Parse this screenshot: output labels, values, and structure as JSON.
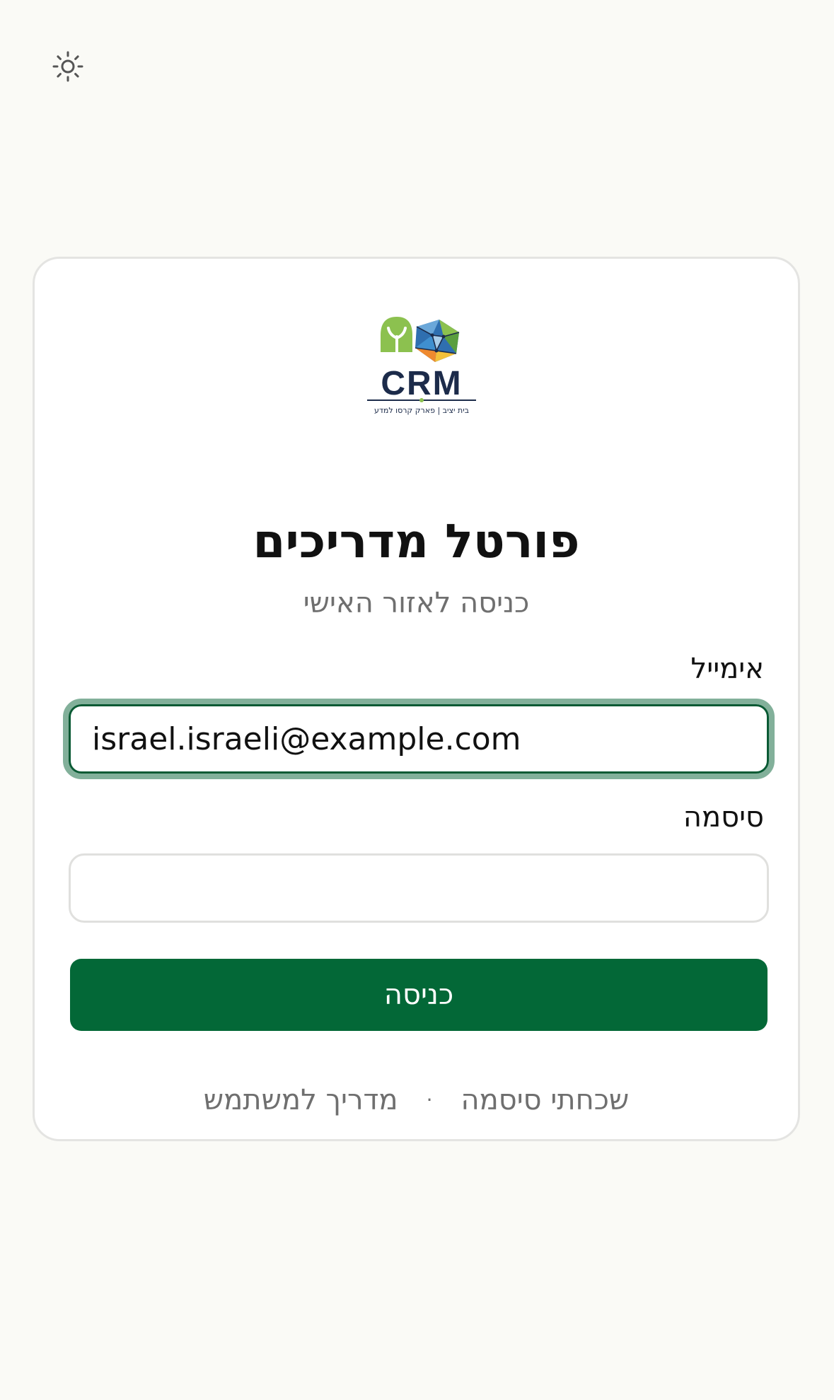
{
  "theme_toggle": {
    "icon": "sun-icon"
  },
  "logo": {
    "wordmark": "CRM",
    "tagline": "בית יציב | פארק קרסו למדע",
    "colors": {
      "green": "#8cc14f",
      "navy": "#1c2b4a",
      "blue": "#3f8fcf",
      "yellow": "#f3c13a",
      "orange": "#ef8a2f"
    }
  },
  "login": {
    "title": "פורטל מדריכים",
    "subtitle": "כניסה לאזור האישי",
    "email_label": "אימייל",
    "email_value": "israel.israeli@example.com",
    "password_label": "סיסמה",
    "submit_label": "כניסה",
    "forgot_password": "שכחתי סיסמה",
    "separator": "·",
    "user_guide": "מדריך למשתמש"
  },
  "colors": {
    "primary": "#036837",
    "focus_ring": "#82b09a",
    "background": "#fafaf6"
  }
}
